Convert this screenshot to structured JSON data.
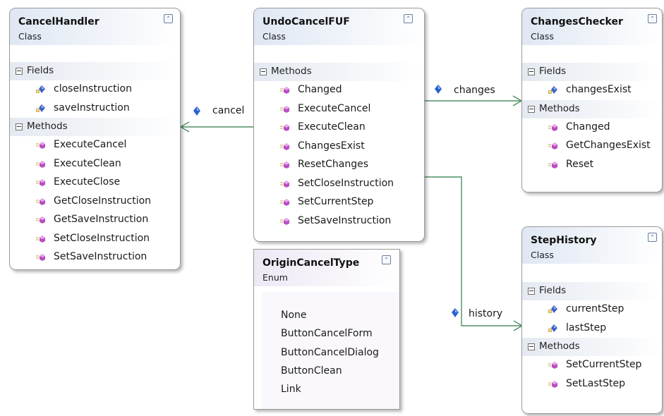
{
  "classes": {
    "cancel_handler": {
      "title": "CancelHandler",
      "type": "Class",
      "fields_label": "Fields",
      "fields": [
        "closeInstruction",
        "saveInstruction"
      ],
      "methods_label": "Methods",
      "methods": [
        "ExecuteCancel",
        "ExecuteClean",
        "ExecuteClose",
        "GetCloseInstruction",
        "GetSaveInstruction",
        "SetCloseInstruction",
        "SetSaveInstruction"
      ]
    },
    "undo_cancel_fuf": {
      "title": "UndoCancelFUF",
      "type": "Class",
      "methods_label": "Methods",
      "methods": [
        "Changed",
        "ExecuteCancel",
        "ExecuteClean",
        "ChangesExist",
        "ResetChanges",
        "SetCloseInstruction",
        "SetCurrentStep",
        "SetSaveInstruction"
      ]
    },
    "changes_checker": {
      "title": "ChangesChecker",
      "type": "Class",
      "fields_label": "Fields",
      "fields": [
        "changesExist"
      ],
      "methods_label": "Methods",
      "methods": [
        "Changed",
        "GetChangesExist",
        "Reset"
      ]
    },
    "step_history": {
      "title": "StepHistory",
      "type": "Class",
      "fields_label": "Fields",
      "fields": [
        "currentStep",
        "lastStep"
      ],
      "methods_label": "Methods",
      "methods": [
        "SetCurrentStep",
        "SetLastStep"
      ]
    }
  },
  "enum": {
    "title": "OriginCancelType",
    "type": "Enum",
    "values": [
      "None",
      "ButtonCancelForm",
      "ButtonCancelDialog",
      "ButtonClean",
      "Link"
    ]
  },
  "associations": {
    "cancel": "cancel",
    "changes": "changes",
    "history": "history"
  },
  "icons": {
    "field": "field-lock-icon",
    "method": "method-cube-icon",
    "property": "property-diamond-icon",
    "collapse": "collapse-chevron-icon"
  },
  "colors": {
    "connector": "#4e8f63",
    "header": "#dfe7f3",
    "enum_header": "#eee8f5",
    "method_icon": "#b94fc2",
    "field_icon": "#3d62c4"
  }
}
